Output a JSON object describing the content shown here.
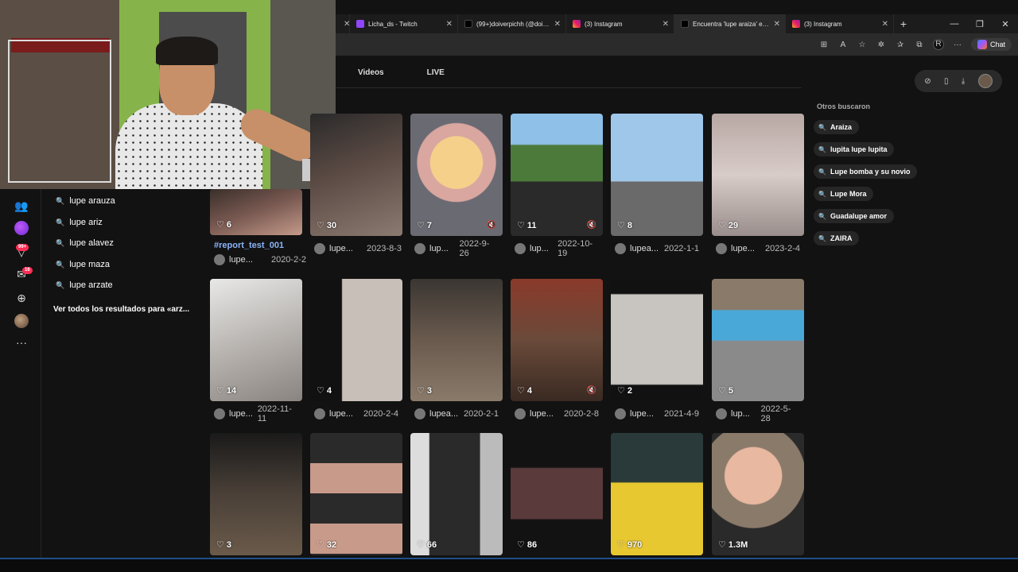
{
  "browser": {
    "tabs": [
      {
        "label": "Licha_ds - Twitch",
        "icon": "twitch-icon",
        "active": false
      },
      {
        "label": "(99+)doiverpichh (@doiverp",
        "icon": "tiktok-icon",
        "active": false
      },
      {
        "label": "(3) Instagram",
        "icon": "instagram-icon",
        "active": false
      },
      {
        "label": "Encuentra 'lupe araiza' en Ti",
        "icon": "tiktok-icon",
        "active": true
      },
      {
        "label": "(3) Instagram",
        "icon": "instagram-icon",
        "active": false
      }
    ],
    "chat_label": "Chat"
  },
  "sidebar": {
    "badges": {
      "inbox": "99+",
      "messages": "16"
    }
  },
  "suggestions": {
    "items": [
      "lupe arauza",
      "lupe ariz",
      "lupe alavez",
      "lupe maza",
      "lupe arzate"
    ],
    "see_all": "Ver todos los resultados para «arz..."
  },
  "main": {
    "tabs": [
      "Videos",
      "LIVE"
    ],
    "hashtag": "#report_test_001"
  },
  "others": {
    "title": "Otros buscaron",
    "items": [
      "Araiza",
      "lupita lupe lupita",
      "Lupe bomba y su novio",
      "Lupe Mora",
      "Guadalupe amor",
      "ZAIRA"
    ]
  },
  "videos": [
    {
      "likes": "6",
      "author": "lupe...",
      "date": "2020-2-2",
      "muted": false
    },
    {
      "likes": "30",
      "author": "lupe...",
      "date": "2023-8-3",
      "muted": false
    },
    {
      "likes": "7",
      "author": "lup...",
      "date": "2022-9-26",
      "muted": true
    },
    {
      "likes": "11",
      "author": "lup...",
      "date": "2022-10-19",
      "muted": true
    },
    {
      "likes": "8",
      "author": "lupea...",
      "date": "2022-1-1",
      "muted": false
    },
    {
      "likes": "29",
      "author": "lupe...",
      "date": "2023-2-4",
      "muted": false
    },
    {
      "likes": "14",
      "author": "lupe...",
      "date": "2022-11-11",
      "muted": false
    },
    {
      "likes": "4",
      "author": "lupe...",
      "date": "2020-2-4",
      "muted": false
    },
    {
      "likes": "3",
      "author": "lupea...",
      "date": "2020-2-1",
      "muted": false
    },
    {
      "likes": "4",
      "author": "lupe...",
      "date": "2020-2-8",
      "muted": true
    },
    {
      "likes": "2",
      "author": "lupe...",
      "date": "2021-4-9",
      "muted": false
    },
    {
      "likes": "5",
      "author": "lup...",
      "date": "2022-5-28",
      "muted": false
    },
    {
      "likes": "3",
      "author": "",
      "date": "",
      "muted": false
    },
    {
      "likes": "32",
      "author": "",
      "date": "",
      "muted": false
    },
    {
      "likes": "66",
      "author": "",
      "date": "",
      "muted": false
    },
    {
      "likes": "86",
      "author": "",
      "date": "",
      "muted": false
    },
    {
      "likes": "970",
      "author": "",
      "date": "",
      "muted": false
    },
    {
      "likes": "1.3M",
      "author": "",
      "date": "",
      "muted": false
    }
  ]
}
